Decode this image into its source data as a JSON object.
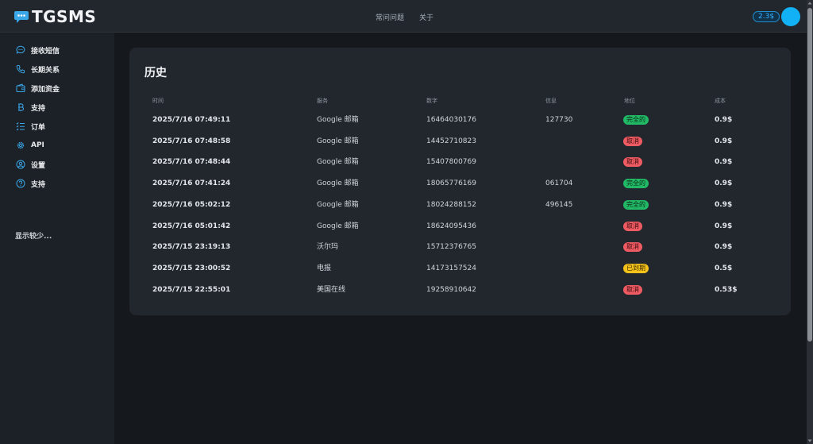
{
  "app": {
    "name": "TGSMS"
  },
  "topnav": {
    "faq": "常问问题",
    "about": "关于"
  },
  "balance": "2.3$",
  "sidebar": {
    "items": [
      {
        "label": "接收短信",
        "icon": "chat-bubble-icon"
      },
      {
        "label": "长期关系",
        "icon": "phone-icon"
      },
      {
        "label": "添加资金",
        "icon": "wallet-icon"
      },
      {
        "label": "支持",
        "icon": "bitcoin-icon"
      },
      {
        "label": "订单",
        "icon": "list-icon"
      },
      {
        "label": "API",
        "icon": "gear-icon"
      },
      {
        "label": "设置",
        "icon": "user-circle-icon"
      },
      {
        "label": "支持",
        "icon": "help-circle-icon"
      }
    ],
    "show_less": "显示较少..."
  },
  "history": {
    "title": "历史",
    "columns": {
      "time": "时间",
      "service": "服务",
      "number": "数字",
      "info": "信息",
      "status": "地位",
      "cost": "成本"
    },
    "rows": [
      {
        "time": "2025/7/16 07:49:11",
        "service": "Google 邮箱",
        "number": "16464030176",
        "info": "127730",
        "status": "完全的",
        "status_color": "#21b866",
        "cost": "0.9$"
      },
      {
        "time": "2025/7/16 07:48:58",
        "service": "Google 邮箱",
        "number": "14452710823",
        "info": "",
        "status": "取消",
        "status_color": "#ef5b63",
        "cost": "0.9$"
      },
      {
        "time": "2025/7/16 07:48:44",
        "service": "Google 邮箱",
        "number": "15407800769",
        "info": "",
        "status": "取消",
        "status_color": "#ef5b63",
        "cost": "0.9$"
      },
      {
        "time": "2025/7/16 07:41:24",
        "service": "Google 邮箱",
        "number": "18065776169",
        "info": "061704",
        "status": "完全的",
        "status_color": "#21b866",
        "cost": "0.9$"
      },
      {
        "time": "2025/7/16 05:02:12",
        "service": "Google 邮箱",
        "number": "18024288152",
        "info": "496145",
        "status": "完全的",
        "status_color": "#21b866",
        "cost": "0.9$"
      },
      {
        "time": "2025/7/16 05:01:42",
        "service": "Google 邮箱",
        "number": "18624095436",
        "info": "",
        "status": "取消",
        "status_color": "#ef5b63",
        "cost": "0.9$"
      },
      {
        "time": "2025/7/15 23:19:13",
        "service": "沃尔玛",
        "number": "15712376765",
        "info": "",
        "status": "取消",
        "status_color": "#ef5b63",
        "cost": "0.9$"
      },
      {
        "time": "2025/7/15 23:00:52",
        "service": "电报",
        "number": "14173157524",
        "info": "",
        "status": "已到期",
        "status_color": "#f4c21b",
        "cost": "0.5$"
      },
      {
        "time": "2025/7/15 22:55:01",
        "service": "美国在线",
        "number": "19258910642",
        "info": "",
        "status": "取消",
        "status_color": "#ef5b63",
        "cost": "0.53$"
      }
    ]
  }
}
